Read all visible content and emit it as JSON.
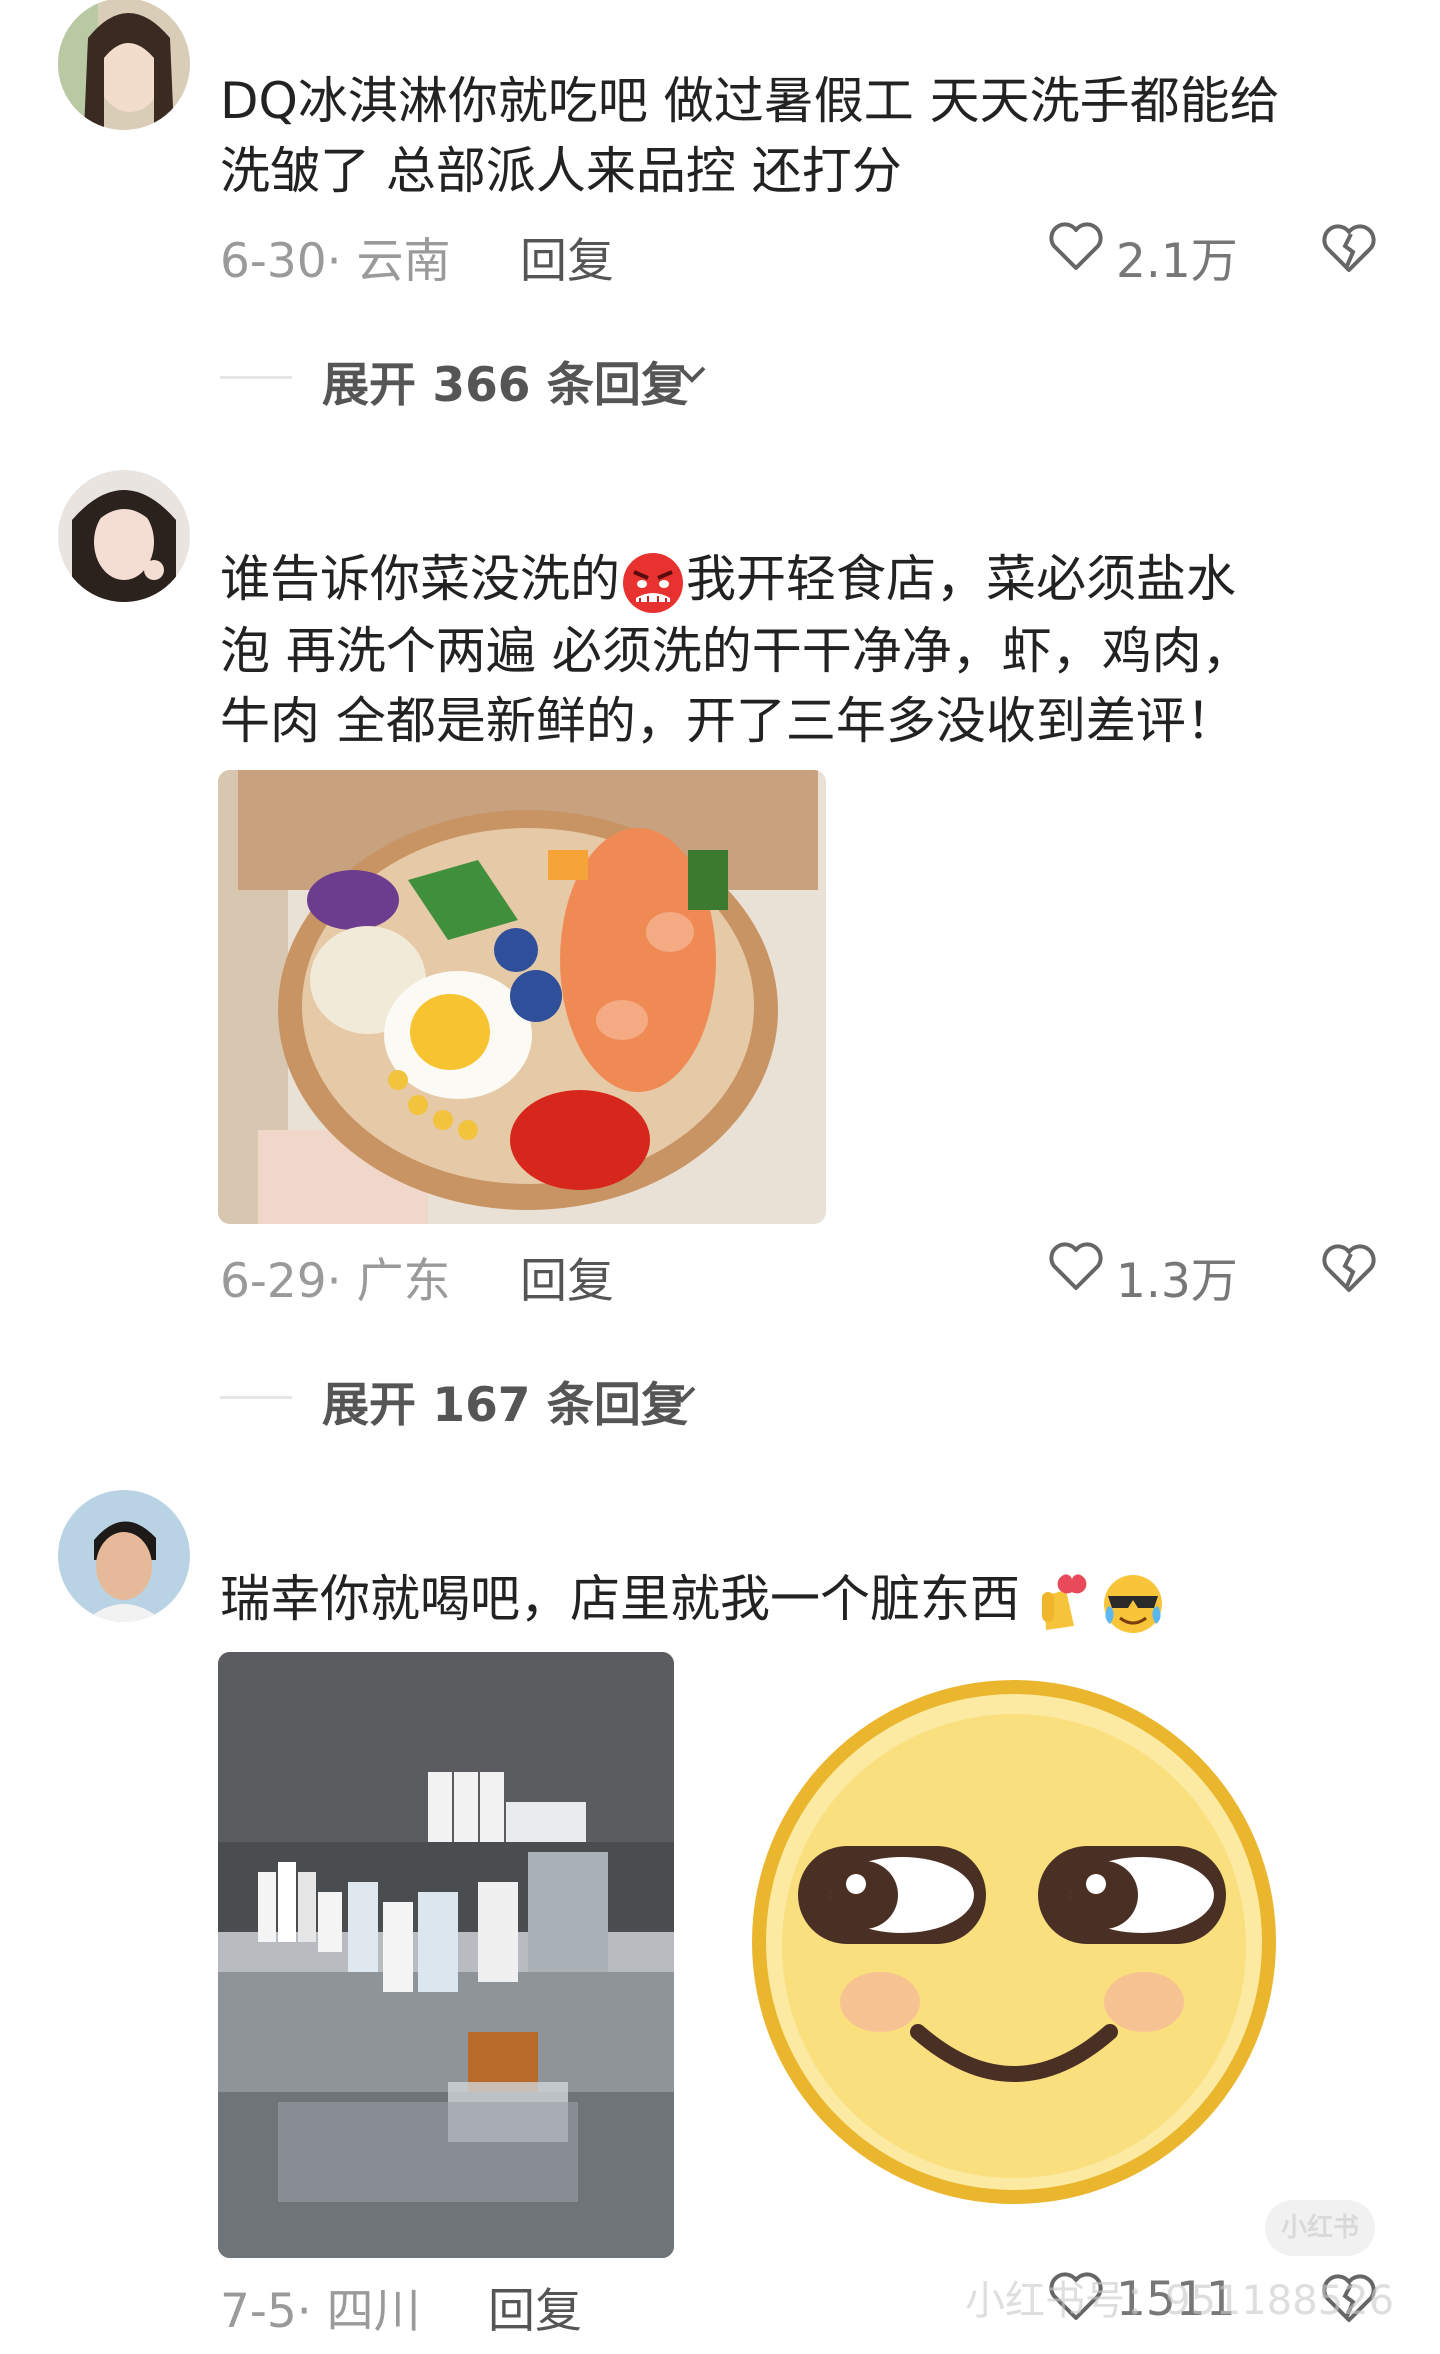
{
  "comments": [
    {
      "text_line1": "DQ冰淇淋你就吃吧 做过暑假工 天天洗手都能给",
      "text_line2": "洗皱了 总部派人来品控 还打分",
      "date_loc": "6-30· 云南",
      "reply_label": "回复",
      "like_count": "2.1万",
      "expand_label": "展开 366 条回复"
    },
    {
      "text_line1a": "谁告诉你菜没洗的",
      "emoji1": "angry-face",
      "text_line1b": "我开轻食店，菜必须盐水",
      "text_line2": "泡 再洗个两遍 必须洗的干干净净，虾，鸡肉，",
      "text_line3": "牛肉 全都是新鲜的，开了三年多没收到差评！",
      "date_loc": "6-29· 广东",
      "reply_label": "回复",
      "like_count": "1.3万",
      "expand_label": "展开 167 条回复"
    },
    {
      "text": "瑞幸你就喝吧，店里就我一个脏东西",
      "emoji1": "finger-heart",
      "emoji2": "cool-tears-face",
      "date_loc": "7-5· 四川",
      "reply_label": "回复",
      "like_count": "1511"
    }
  ],
  "watermark": {
    "badge": "小红书",
    "text": "小红书号：951188526"
  },
  "colors": {
    "text": "#222222",
    "meta": "#9a9a9a",
    "background": "#ffffff"
  }
}
